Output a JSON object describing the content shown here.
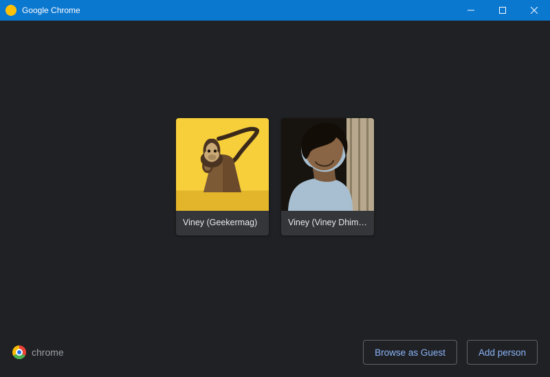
{
  "window": {
    "title": "Google Chrome"
  },
  "profiles": [
    {
      "label": "Viney (Geekermag)"
    },
    {
      "label": "Viney (Viney Dhim…"
    }
  ],
  "footer": {
    "brand": "chrome",
    "guest_label": "Browse as Guest",
    "add_label": "Add person"
  }
}
